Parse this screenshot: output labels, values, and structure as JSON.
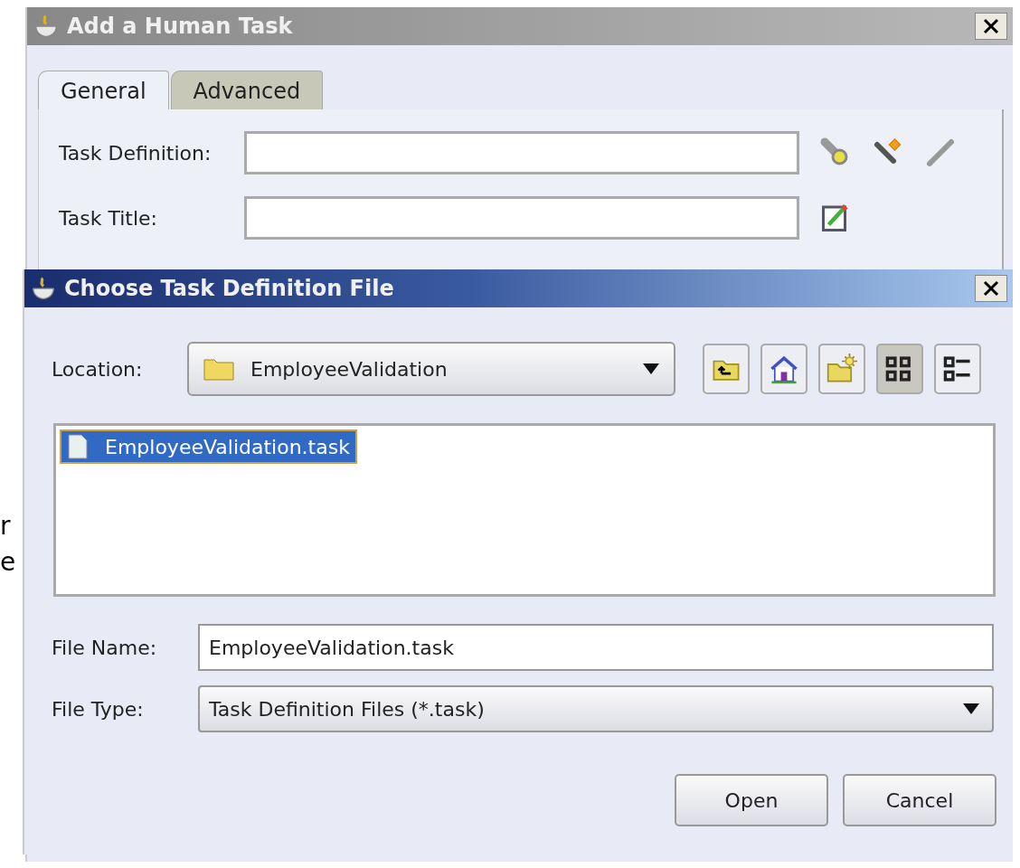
{
  "background_text": [
    "r",
    "e"
  ],
  "dialog": {
    "title": "Add a Human Task",
    "tabs": [
      {
        "label": "General",
        "selected": true
      },
      {
        "label": "Advanced",
        "selected": false
      }
    ],
    "fields": [
      {
        "label": "Task Definition:",
        "kind": "definition"
      },
      {
        "label": "Task Title:",
        "kind": "title"
      }
    ]
  },
  "file_dialog": {
    "title": "Choose Task Definition File",
    "location": {
      "label": "Location:",
      "value": "EmployeeValidation"
    },
    "toolbar": [
      {
        "kind": "up",
        "selected": false
      },
      {
        "kind": "home",
        "selected": false
      },
      {
        "kind": "new-folder",
        "selected": false
      },
      {
        "kind": "icons",
        "selected": true
      },
      {
        "kind": "details",
        "selected": false
      }
    ],
    "files": [
      {
        "name": "EmployeeValidation.task",
        "selected": true
      }
    ],
    "file_name": {
      "label": "File Name:",
      "value": "EmployeeValidation.task"
    },
    "file_type": {
      "label": "File Type:",
      "value": "Task Definition Files (*.task)"
    },
    "buttons": [
      "Open",
      "Cancel"
    ]
  }
}
